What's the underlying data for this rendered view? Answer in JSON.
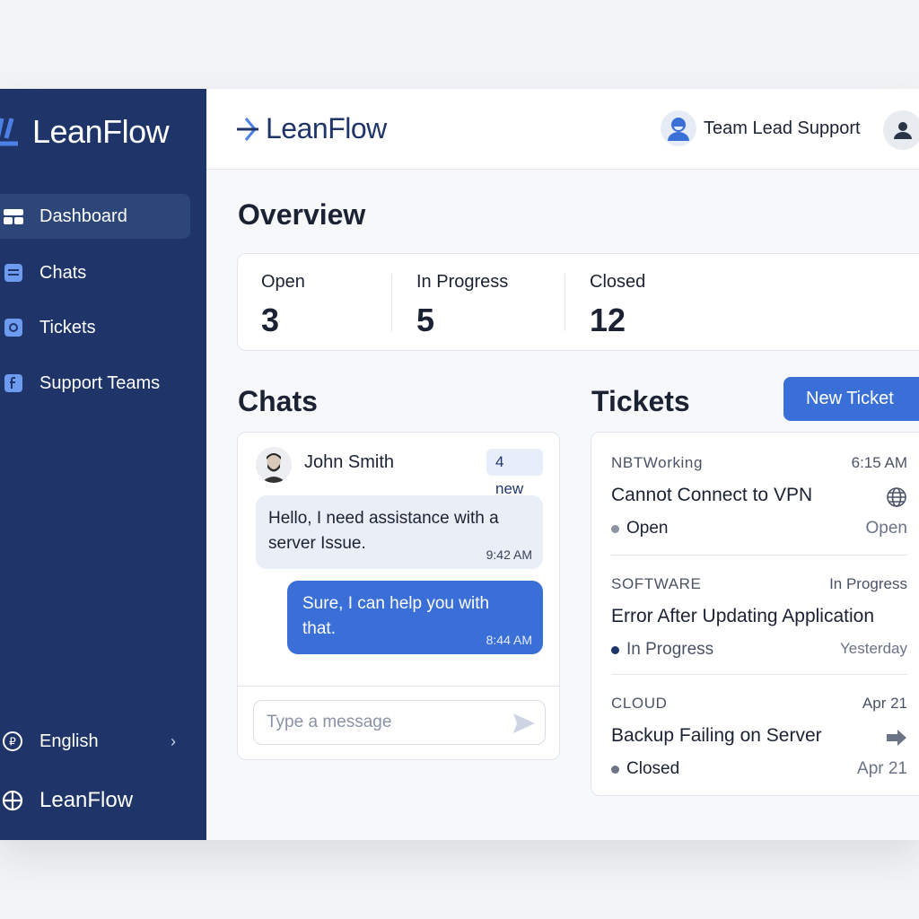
{
  "sidebar": {
    "brand": "LeanFlow",
    "nav": [
      {
        "label": "Dashboard",
        "icon": "dashboard-icon",
        "active": true
      },
      {
        "label": "Chats",
        "icon": "chat-icon",
        "active": false
      },
      {
        "label": "Tickets",
        "icon": "ticket-icon",
        "active": false
      },
      {
        "label": "Support Teams",
        "icon": "team-icon",
        "active": false
      }
    ],
    "language": {
      "label": "English",
      "icon": "language-icon"
    },
    "footer_brand": "LeanFlow"
  },
  "topbar": {
    "brand": "LeanFlow",
    "user_name": "Team Lead Support",
    "profile_icon": "user-icon"
  },
  "overview": {
    "title": "Overview",
    "stats": [
      {
        "label": "Open",
        "value": "3"
      },
      {
        "label": "In Progress",
        "value": "5"
      },
      {
        "label": "Closed",
        "value": "12"
      }
    ]
  },
  "chats": {
    "title": "Chats",
    "contact": "John Smith",
    "badge": "4 new",
    "messages": [
      {
        "direction": "in",
        "text": "Hello, I need assistance with a server Issue.",
        "time": "9:42 AM"
      },
      {
        "direction": "out",
        "text": "Sure, I can help you with that.",
        "time": "8:44 AM"
      }
    ],
    "input_placeholder": "Type a message"
  },
  "tickets": {
    "title": "Tickets",
    "new_button": "New Ticket",
    "items": [
      {
        "category": "NBTWorking",
        "meta": "6:15 AM",
        "title": "Cannot Connect to VPN",
        "icon": "globe-icon",
        "status": "Open",
        "right": "Open"
      },
      {
        "category": "SOFTWARE",
        "meta": "In Progress",
        "title": "Error After Updating Application",
        "icon": "",
        "status": "In Progress",
        "right": "Yesterday"
      },
      {
        "category": "CLOUD",
        "meta": "Apr 21",
        "title": "Backup Failing on Server",
        "icon": "arrow-right-icon",
        "status": "Closed",
        "right": "Apr 21"
      }
    ]
  },
  "colors": {
    "sidebar": "#1f3569",
    "accent": "#3a6fd8",
    "dot_open": "#8a92a3",
    "dot_progress": "#1f3569",
    "dot_closed": "#6b7386"
  }
}
